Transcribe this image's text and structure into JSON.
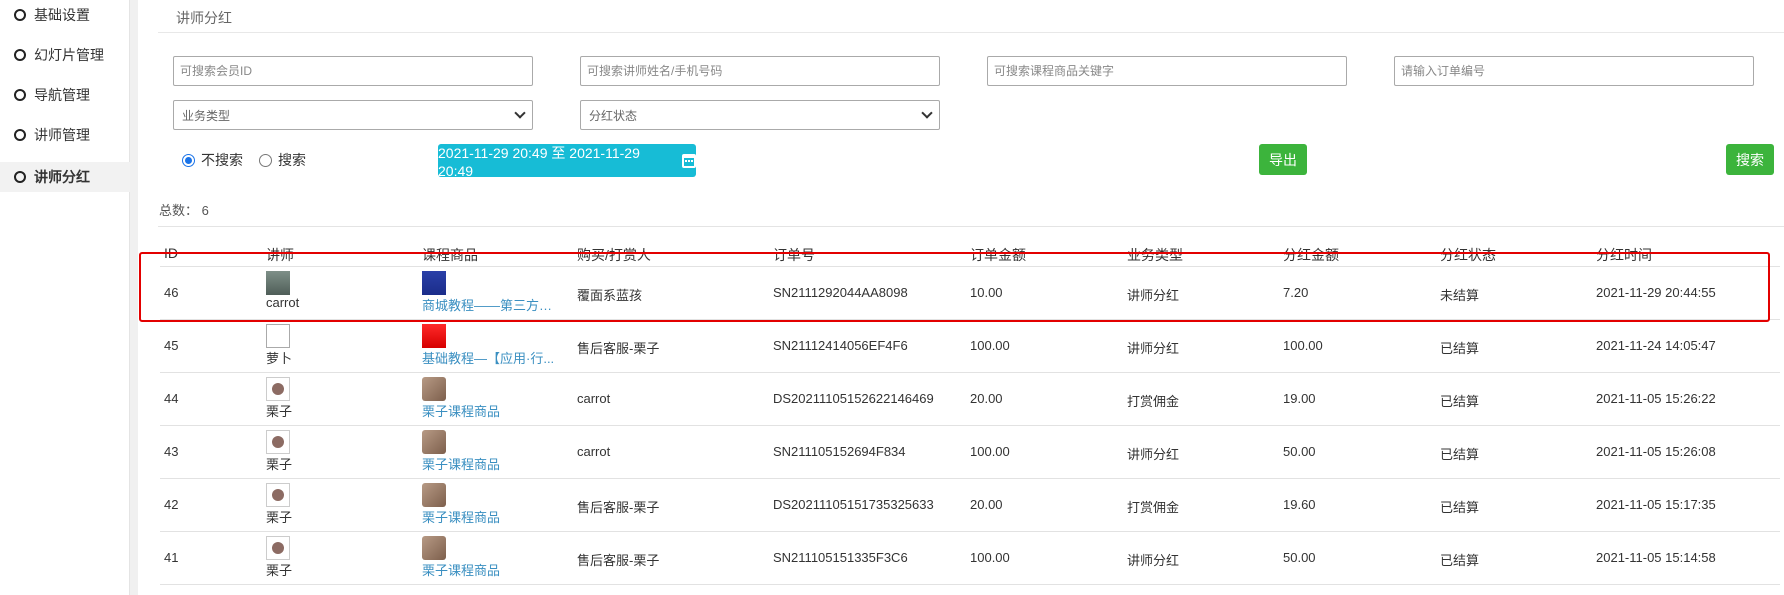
{
  "sidebar": {
    "items": [
      {
        "label": "基础设置",
        "active": false
      },
      {
        "label": "幻灯片管理",
        "active": false
      },
      {
        "label": "导航管理",
        "active": false
      },
      {
        "label": "讲师管理",
        "active": false
      },
      {
        "label": "讲师分红",
        "active": true
      }
    ]
  },
  "page": {
    "title": "讲师分红"
  },
  "filters": {
    "member_id_placeholder": "可搜索会员ID",
    "teacher_placeholder": "可搜索讲师姓名/手机号码",
    "product_placeholder": "可搜索课程商品关键字",
    "order_placeholder": "请输入订单编号",
    "business_type": "业务类型",
    "dividend_status": "分红状态",
    "radio_no_search": "不搜索",
    "radio_search": "搜索",
    "date_range": "2021-11-29 20:49 至 2021-11-29 20:49",
    "export_label": "导出",
    "search_label": "搜索"
  },
  "summary": {
    "total": "总数： 6"
  },
  "table": {
    "headers": [
      "ID",
      "讲师",
      "课程商品",
      "购买/打赏人",
      "订单号",
      "订单金额",
      "业务类型",
      "分红金额",
      "分红状态",
      "分红时间"
    ],
    "rows": [
      {
        "id": "46",
        "teacher": "carrot",
        "product": "商城教程——第三方配...",
        "buyer": "覆面系蓝孩",
        "order": "SN2111292044AA8098",
        "amount": "10.00",
        "type": "讲师分红",
        "dividend": "7.20",
        "status": "未结算",
        "time": "2021-11-29 20:44:55"
      },
      {
        "id": "45",
        "teacher": "萝卜",
        "product": "基础教程—【应用·行...",
        "buyer": "售后客服-栗子",
        "order": "SN21112414056EF4F6",
        "amount": "100.00",
        "type": "讲师分红",
        "dividend": "100.00",
        "status": "已结算",
        "time": "2021-11-24 14:05:47"
      },
      {
        "id": "44",
        "teacher": "栗子",
        "product": "栗子课程商品",
        "buyer": "carrot",
        "order": "DS20211105152622146469",
        "amount": "20.00",
        "type": "打赏佣金",
        "dividend": "19.00",
        "status": "已结算",
        "time": "2021-11-05 15:26:22"
      },
      {
        "id": "43",
        "teacher": "栗子",
        "product": "栗子课程商品",
        "buyer": "carrot",
        "order": "SN211105152694F834",
        "amount": "100.00",
        "type": "讲师分红",
        "dividend": "50.00",
        "status": "已结算",
        "time": "2021-11-05 15:26:08"
      },
      {
        "id": "42",
        "teacher": "栗子",
        "product": "栗子课程商品",
        "buyer": "售后客服-栗子",
        "order": "DS20211105151735325633",
        "amount": "20.00",
        "type": "打赏佣金",
        "dividend": "19.60",
        "status": "已结算",
        "time": "2021-11-05 15:17:35"
      },
      {
        "id": "41",
        "teacher": "栗子",
        "product": "栗子课程商品",
        "buyer": "售后客服-栗子",
        "order": "SN211105151335F3C6",
        "amount": "100.00",
        "type": "讲师分红",
        "dividend": "50.00",
        "status": "已结算",
        "time": "2021-11-05 15:14:58"
      }
    ]
  },
  "colors": {
    "accent_cyan": "#17bcd6",
    "button_green": "#3cb43c",
    "link_blue": "#3a8fc1",
    "highlight_red": "#e30000"
  }
}
